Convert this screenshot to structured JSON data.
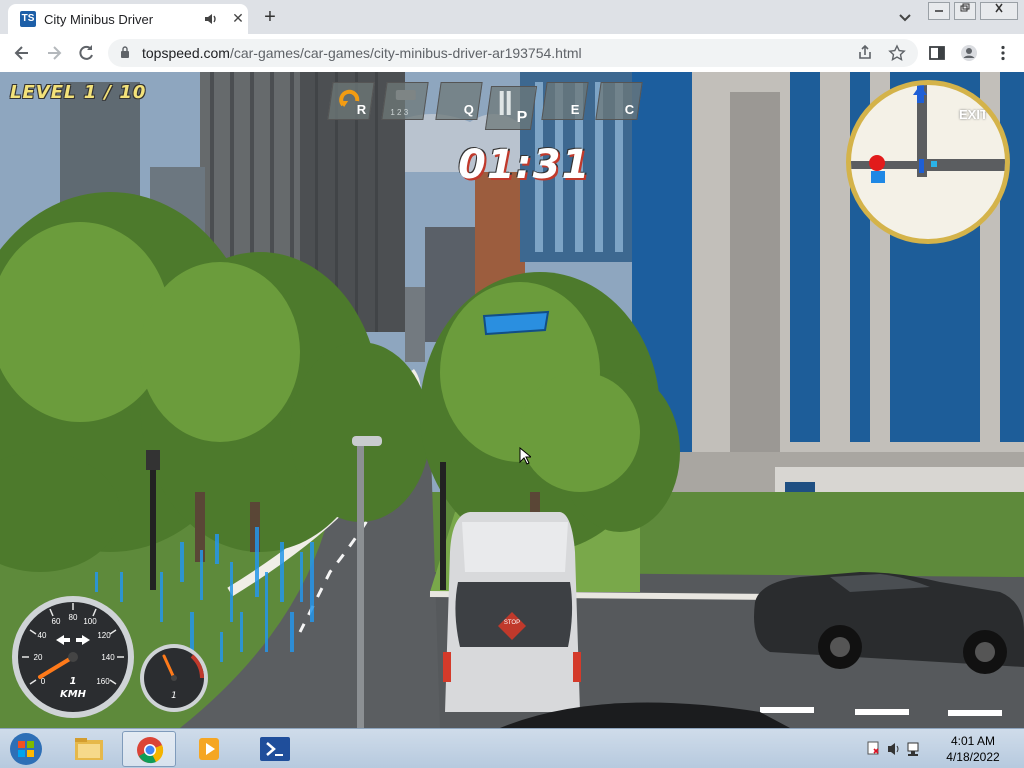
{
  "browser": {
    "tab_title": "City Minibus Driver",
    "tab_favicon_text": "TS",
    "new_tab_symbol": "+",
    "close_symbol": "✕",
    "url_host": "topspeed.com",
    "url_path": "/car-games/car-games/city-minibus-driver-ar193754.html"
  },
  "hud": {
    "level": "LEVEL 1 / 10",
    "timer": "01:31",
    "buttons": [
      {
        "key": "R",
        "icon": "reset-icon"
      },
      {
        "key": "",
        "sub": "1 2 3",
        "icon": "camera-icon"
      },
      {
        "key": "Q",
        "icon": "left-signal-icon"
      },
      {
        "key": "P",
        "icon": "park-icon"
      },
      {
        "key": "E",
        "icon": "right-signal-icon"
      },
      {
        "key": "C",
        "icon": "camera-switch-icon"
      }
    ],
    "minimap_label": "EXIT",
    "speed_value": "1",
    "speed_unit": "KMH",
    "speed_ticks": [
      "0",
      "20",
      "40",
      "60",
      "80",
      "100",
      "120",
      "140",
      "160"
    ],
    "rpm_value": "1",
    "stop_sign": "STOP"
  },
  "taskbar": {
    "time": "4:01 AM",
    "date": "4/18/2022",
    "apps": [
      "file-explorer-icon",
      "chrome-icon",
      "media-player-icon",
      "powershell-icon"
    ]
  },
  "colors": {
    "level_text": "#f3e27a",
    "minimap_ring": "#d4b34a",
    "checkpoint": "#2a8fe0",
    "needle": "#ff7a1a"
  }
}
